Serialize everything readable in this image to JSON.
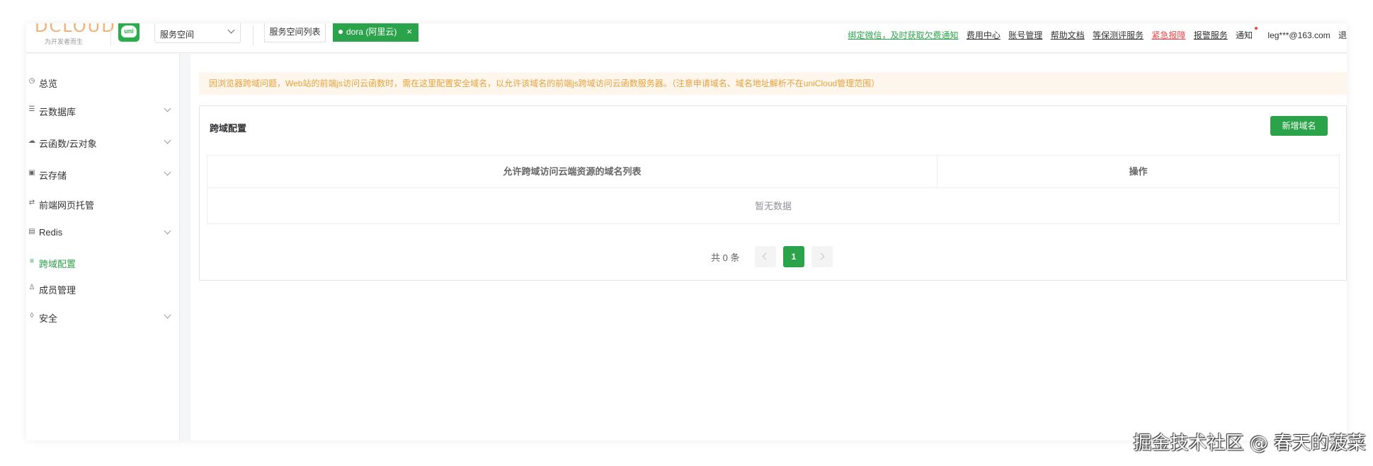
{
  "header": {
    "logo_text": "DCLOUD",
    "logo_slogan": "为开发者而生",
    "uni_badge": "uni",
    "space_select_value": "服务空间",
    "space_list_button": "服务空间列表",
    "current_space_tag": "dora (阿里云)",
    "close_tag": "×",
    "links": {
      "bind_wechat": "绑定微信，及时获取欠费通知",
      "billing": "费用中心",
      "account": "账号管理",
      "docs": "帮助文档",
      "security_eval": "等保测评服务",
      "emergency": "紧急报障",
      "alarm": "报警服务",
      "notice": "通知",
      "email": "leg***@163.com",
      "logout": "退"
    }
  },
  "sidebar": {
    "items": [
      {
        "label": "总览",
        "icon": "dashboard-icon",
        "expandable": false
      },
      {
        "label": "云数据库",
        "icon": "database-icon",
        "expandable": true
      },
      {
        "label": "云函数/云对象",
        "icon": "cloud-function-icon",
        "expandable": true
      },
      {
        "label": "云存储",
        "icon": "storage-icon",
        "expandable": true
      },
      {
        "label": "前端网页托管",
        "icon": "hosting-icon",
        "expandable": false
      },
      {
        "label": "Redis",
        "icon": "redis-icon",
        "expandable": true
      },
      {
        "label": "跨域配置",
        "icon": "cors-icon",
        "expandable": false,
        "active": true
      },
      {
        "label": "成员管理",
        "icon": "member-icon",
        "expandable": false
      },
      {
        "label": "安全",
        "icon": "shield-icon",
        "expandable": true
      }
    ]
  },
  "main": {
    "notice": "因浏览器跨域问题，Web站的前端js访问云函数时，需在这里配置安全域名，以允许该域名的前端js跨域访问云函数服务器。（注意申请域名、域名地址解析不在uniCloud管理范围）",
    "card_title": "跨域配置",
    "add_button": "新增域名",
    "table": {
      "columns": [
        "允许跨域访问云端资源的域名列表",
        "操作"
      ],
      "empty_text": "暂无数据"
    },
    "pagination": {
      "total_text": "共 0 条",
      "current_page": "1"
    }
  },
  "watermark": "掘金技术社区 @ 春天的菠菜",
  "colors": {
    "brand_green": "#2aa34a",
    "notice_bg": "#fdf6ec",
    "notice_text": "#e6a23c",
    "danger_red": "#e14a4a"
  }
}
